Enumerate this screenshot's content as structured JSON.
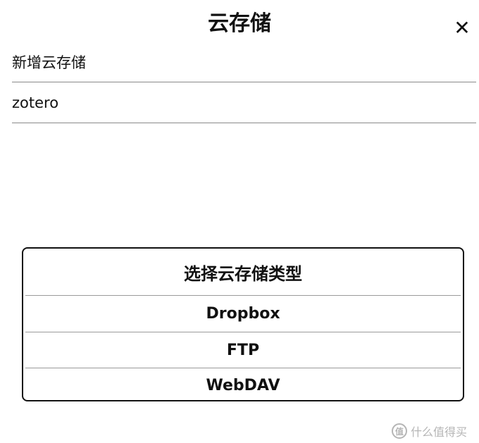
{
  "header": {
    "title": "云存储",
    "close_icon": "close-icon",
    "close_glyph": "✕"
  },
  "storage_list": {
    "items": [
      {
        "label": "新增云存储"
      },
      {
        "label": "zotero"
      }
    ]
  },
  "type_dialog": {
    "title": "选择云存储类型",
    "options": [
      {
        "label": "Dropbox"
      },
      {
        "label": "FTP"
      },
      {
        "label": "WebDAV"
      }
    ]
  },
  "watermark": {
    "logo_glyph": "值",
    "text": "什么值得买"
  },
  "colors": {
    "text": "#111111",
    "divider": "#8a8a8a",
    "watermark": "#b5b5b5",
    "background": "#ffffff"
  }
}
